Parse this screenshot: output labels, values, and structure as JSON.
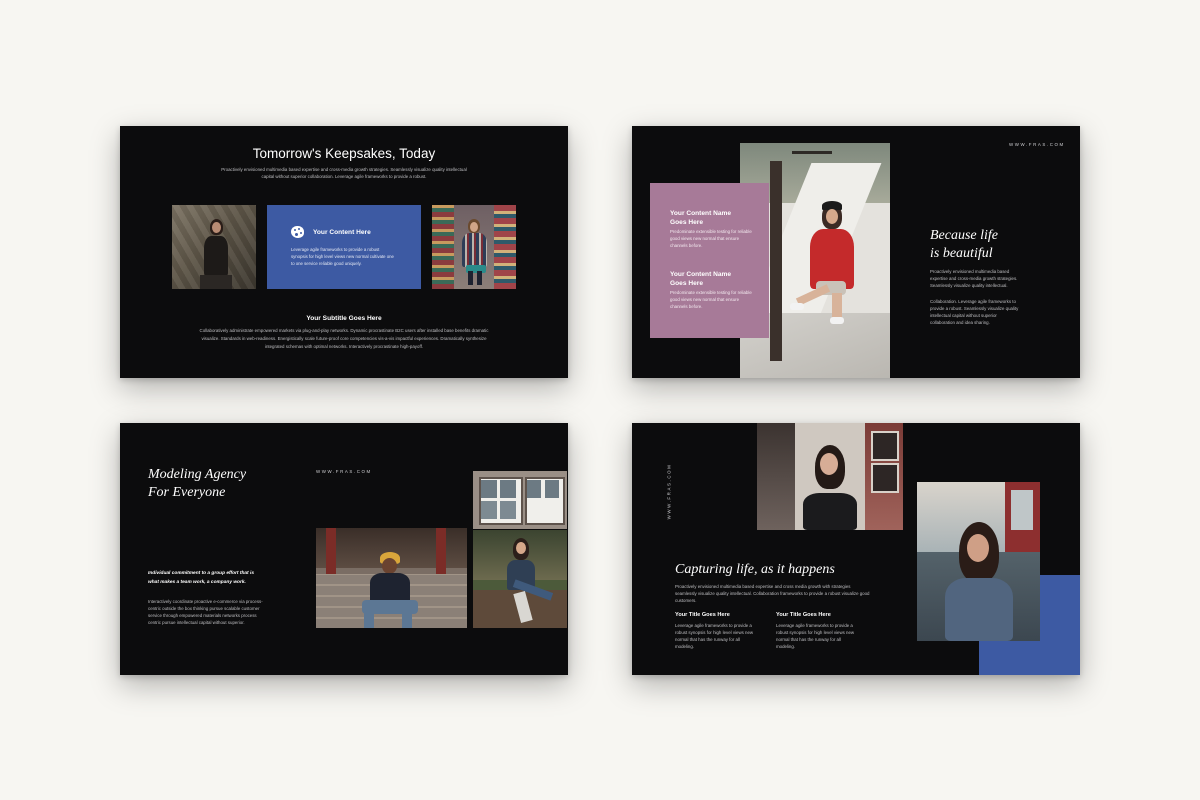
{
  "slide1": {
    "title": "Tomorrow's Keepsakes, Today",
    "intro": "Proactively envisioned multimedia based expertise and cross-media growth strategies. Seamlessly visualize quality intellectual capital without superior collaboration. Leverage agile frameworks to provide a robust.",
    "card_title": "Your Content Here",
    "card_text": "Leverage agile frameworks to provide a robust synopsis for high level views new normal cultivate one to one service reliable good uniquely.",
    "card_icon": "palette-icon",
    "subtitle": "Your Subtitle Goes Here",
    "body": "Collaboratively administrate empowered markets via plug-and-play networks. Dynamic procrastinate B2C users after installed base benefits dramatic visualize. Standards in web-readiness. Energistically scale future-proof core competencies vis-a-vis impactful experiences. Dramatically synthesize integrated schemas with optimal networks. Interactively procrastinate high-payoff."
  },
  "slide2": {
    "website": "WWW.FRAS.COM",
    "content1_title": "Your Content Name Goes Here",
    "content1_text": "Predominate extensible testing for reliable good views new normal that ensure channels before.",
    "content2_title": "Your Content Name Goes Here",
    "content2_text": "Predominate extensible testing for reliable good views new normal that ensure channels before.",
    "heading_line1": "Because life",
    "heading_line2": "is beautiful",
    "para1": "Proactively envisioned multimedia based expertise and cross-media growth strategies. Seamlessly visualize quality intellectual.",
    "para2": "Collaboration. Leverage agile frameworks to provide a robust. Seamlessly visualize quality intellectual capital without superior collaboration and idea sharing.",
    "panel_color": "#a77a98"
  },
  "slide3": {
    "heading_line1": "Modeling Agency",
    "heading_line2": "For Everyone",
    "website": "WWW.FRAS.COM",
    "quote": "Individual commitment to a group effort that is what makes a team work, a company work.",
    "body": "Interactively coordinate proactive e-commerce via process-centric outside the box thinking pursue scalable customer service through empowered materials networks process centric pursue intellectual capital without superior."
  },
  "slide4": {
    "website": "WWW.FRAS.COM",
    "heading": "Capturing life, as it happens",
    "intro": "Proactively envisioned multimedia based expertise and cross media growth with strategies seamlessly visualize quality intellectual. Collaboration frameworks to provide a robust visualize good customers.",
    "col1_title": "Your Title Goes Here",
    "col1_text": "Leverage agile frameworks to provide a robust synopsis for high level views new normal that has the runway for all modeling.",
    "col2_title": "Your Title Goes Here",
    "col2_text": "Leverage agile frameworks to provide a robust synopsis for high level views new normal that has the runway for all modeling.",
    "accent_color": "#3d5aa3"
  },
  "colors": {
    "background": "#f7f6f2",
    "slide": "#0c0c0d",
    "blue": "#3d5aa3",
    "mauve": "#a77a98"
  }
}
